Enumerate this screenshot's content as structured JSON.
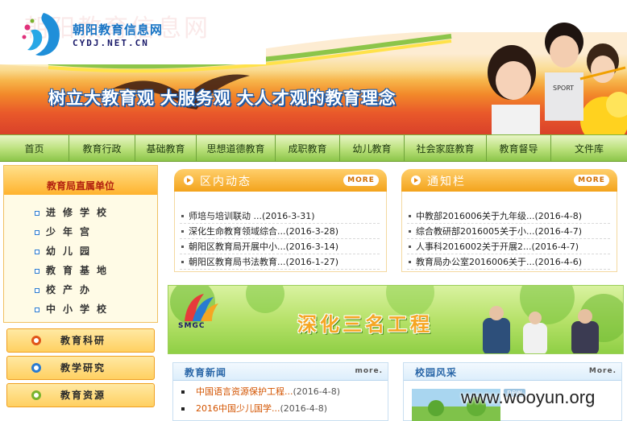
{
  "header": {
    "faint_watermark": "朝阳教育信息网",
    "logo_cn": "朝阳教育信息网",
    "logo_en": "CYDJ.NET.CN",
    "slogan": "树立大教育观  大服务观  大人才观的教育理念",
    "kids_shirt_text": "SPORT"
  },
  "nav": {
    "items": [
      "首页",
      "教育行政",
      "基础教育",
      "思想道德教育",
      "成职教育",
      "幼儿教育",
      "社会家庭教育",
      "教育督导",
      "文件库"
    ]
  },
  "sidebar": {
    "units_title": "教育局直属单位",
    "units": [
      "进修学校",
      "少年宫",
      "幼儿园",
      "教育基地",
      "校产办",
      "中小学校"
    ],
    "buttons": [
      {
        "label": "教育科研",
        "ring_color": "#e0561a"
      },
      {
        "label": "教学研究",
        "ring_color": "#2a7bd1"
      },
      {
        "label": "教育资源",
        "ring_color": "#7ab32e"
      }
    ]
  },
  "district_news": {
    "title": "区内动态",
    "more": "MORE",
    "items": [
      {
        "title": "师培与培训联动 ...",
        "date": "(2016-3-31)"
      },
      {
        "title": "深化生命教育领域综合...",
        "date": "(2016-3-28)"
      },
      {
        "title": "朝阳区教育局开展中小...",
        "date": "(2016-3-14)"
      },
      {
        "title": "朝阳区教育局书法教育...",
        "date": "(2016-1-27)"
      }
    ]
  },
  "notices": {
    "title": "通知栏",
    "more": "MORE",
    "items": [
      {
        "title": "中教部2016006关于九年级...",
        "date": "(2016-4-8)"
      },
      {
        "title": "综合教研部2016005关于小...",
        "date": "(2016-4-7)"
      },
      {
        "title": "人事科2016002关于开展2...",
        "date": "(2016-4-7)"
      },
      {
        "title": "教育局办公室2016006关于...",
        "date": "(2016-4-6)"
      }
    ]
  },
  "banner": {
    "text": "深化三名工程",
    "logo_text": "SMGC"
  },
  "edu_news": {
    "title": "教育新闻",
    "more": "more.",
    "items": [
      {
        "title": "中国语言资源保护工程...",
        "date": "(2016-4-8)"
      },
      {
        "title": "2016中国少儿国学...",
        "date": "(2016-4-8)"
      }
    ]
  },
  "campus": {
    "title": "校园风采",
    "more": "More.",
    "new_badge": "new"
  },
  "overlay_watermark": "www.wooyun.org"
}
